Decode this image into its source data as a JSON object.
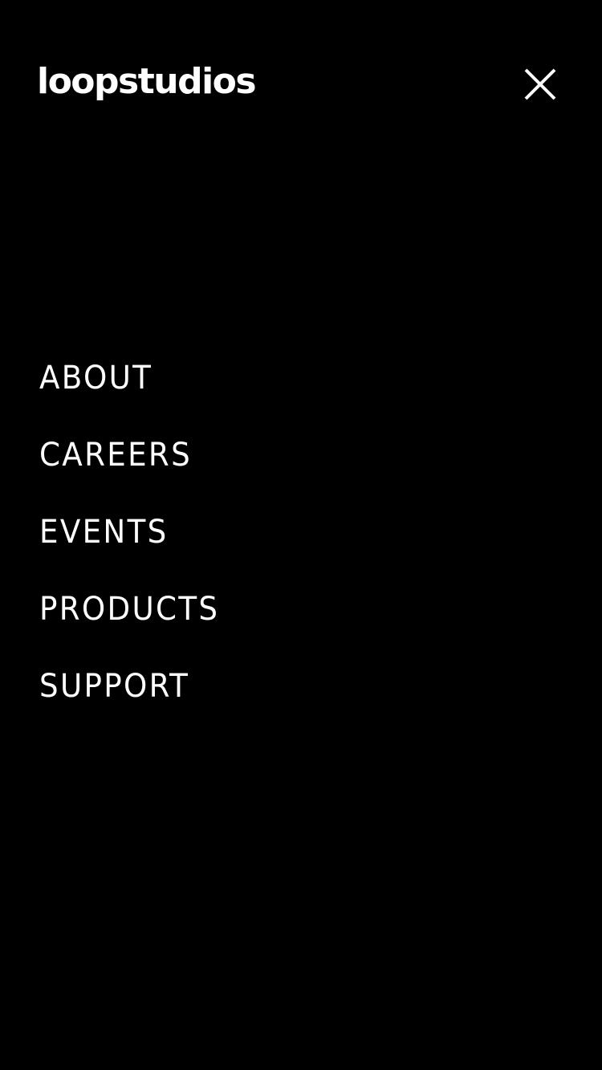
{
  "header": {
    "logo_text": "loopstudios",
    "close_icon": "close-icon"
  },
  "nav": {
    "items": [
      {
        "label": "ABOUT"
      },
      {
        "label": "CAREERS"
      },
      {
        "label": "EVENTS"
      },
      {
        "label": "PRODUCTS"
      },
      {
        "label": "SUPPORT"
      }
    ]
  },
  "colors": {
    "background": "#000000",
    "text": "#ffffff"
  }
}
